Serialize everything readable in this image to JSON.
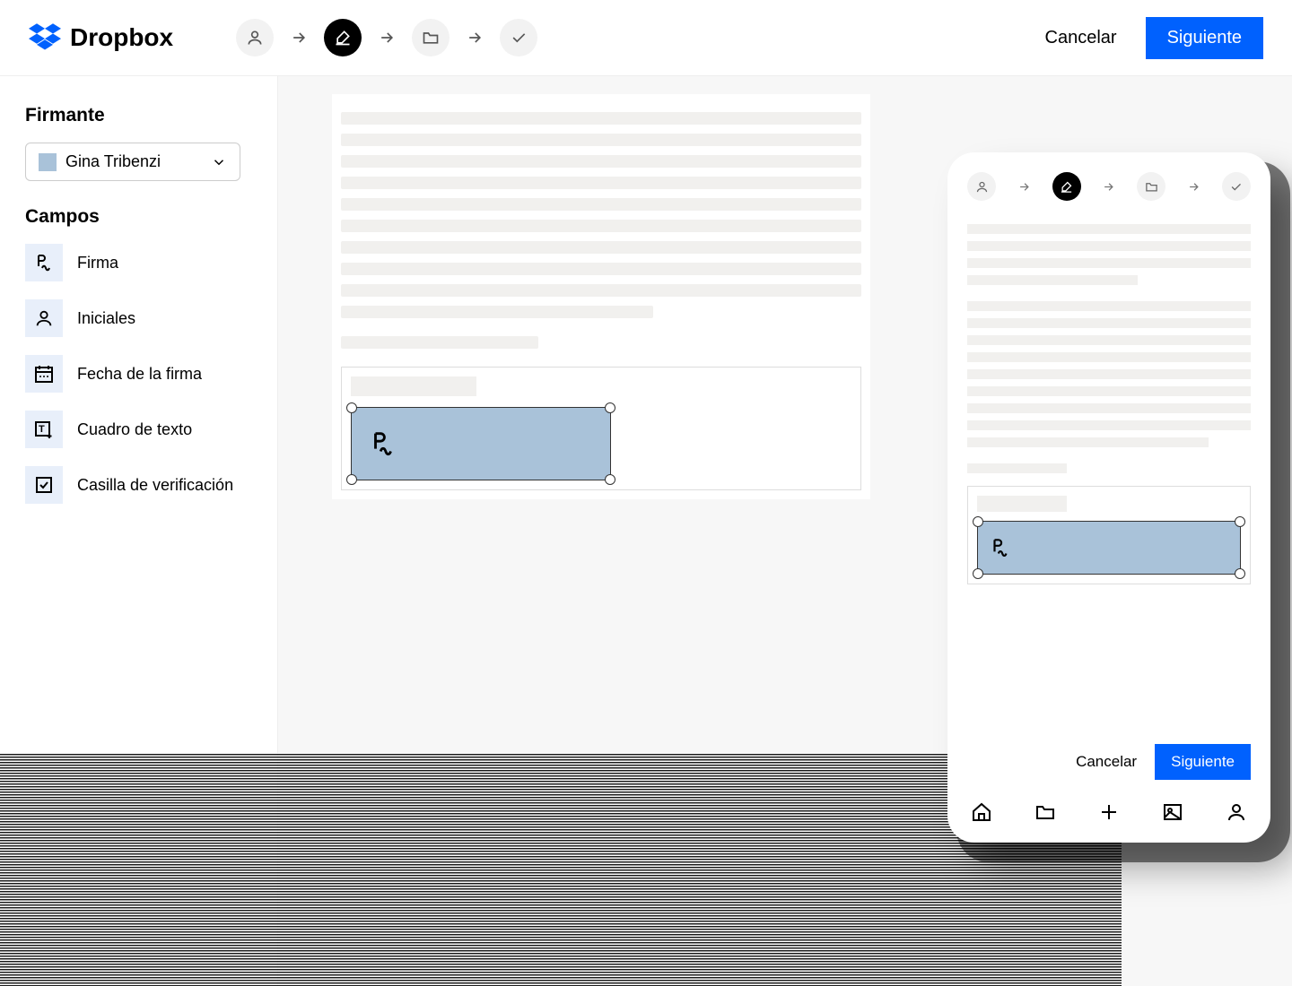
{
  "brand": "Dropbox",
  "header": {
    "cancel": "Cancelar",
    "next": "Siguiente"
  },
  "sidebar": {
    "signer_heading": "Firmante",
    "signer_name": "Gina Tribenzi",
    "fields_heading": "Campos",
    "fields": [
      {
        "label": "Firma",
        "icon": "signature-icon"
      },
      {
        "label": "Iniciales",
        "icon": "person-icon"
      },
      {
        "label": "Fecha de la firma",
        "icon": "date-icon"
      },
      {
        "label": "Cuadro de texto",
        "icon": "textbox-icon"
      },
      {
        "label": "Casilla de verificación",
        "icon": "checkbox-icon"
      }
    ]
  },
  "phone": {
    "cancel": "Cancelar",
    "next": "Siguiente"
  }
}
